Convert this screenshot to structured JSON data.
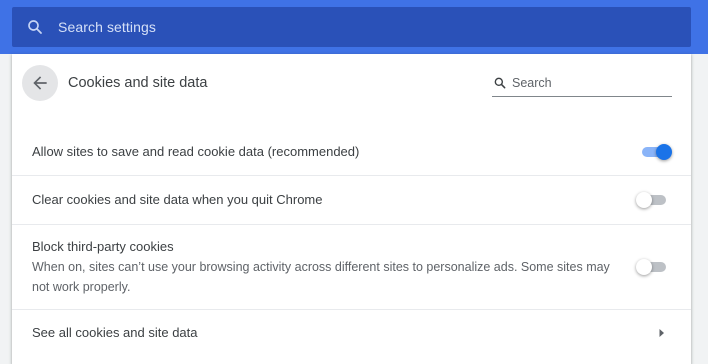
{
  "search": {
    "placeholder": "Search settings"
  },
  "page": {
    "title": "Cookies and site data",
    "search_placeholder": "Search"
  },
  "rows": [
    {
      "label": "Allow sites to save and read cookie data (recommended)",
      "toggle_on": true
    },
    {
      "label": "Clear cookies and site data when you quit Chrome",
      "toggle_on": false
    },
    {
      "label": "Block third-party cookies",
      "description": "When on, sites can’t use your browsing activity across different sites to personalize ads. Some sites may not work properly.",
      "toggle_on": false
    },
    {
      "label": "See all cookies and site data"
    }
  ],
  "colors": {
    "header_bg": "#3f72e6",
    "search_bg": "#2a51b8",
    "accent": "#1a73e8"
  },
  "icons": {
    "search": "search-icon",
    "back": "arrow-back-icon",
    "chevron": "chevron-right-icon"
  }
}
